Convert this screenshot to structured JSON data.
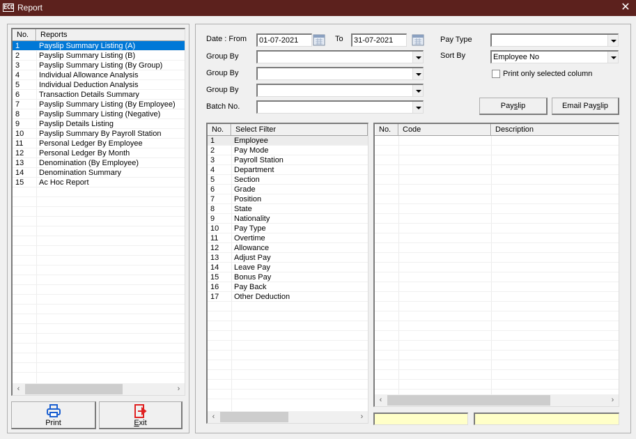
{
  "window": {
    "title": "Report",
    "app_icon": "ECO",
    "close_glyph": "✕"
  },
  "reports": {
    "columns": [
      "No.",
      "Reports"
    ],
    "selected_index": 0,
    "rows": [
      {
        "no": "1",
        "name": "Payslip Summary Listing (A)"
      },
      {
        "no": "2",
        "name": "Payslip Summary Listing (B)"
      },
      {
        "no": "3",
        "name": "Payslip Summary Listing (By Group)"
      },
      {
        "no": "4",
        "name": "Individual Allowance Analysis"
      },
      {
        "no": "5",
        "name": "Individual Deduction Analysis"
      },
      {
        "no": "6",
        "name": "Transaction Details Summary"
      },
      {
        "no": "7",
        "name": "Payslip Summary Listing (By Employee)"
      },
      {
        "no": "8",
        "name": "Payslip Summary Listing (Negative)"
      },
      {
        "no": "9",
        "name": "Payslip Details Listing"
      },
      {
        "no": "10",
        "name": "Payslip Summary By Payroll Station"
      },
      {
        "no": "11",
        "name": "Personal Ledger By Employee"
      },
      {
        "no": "12",
        "name": "Personal Ledger By Month"
      },
      {
        "no": "13",
        "name": "Denomination (By Employee)"
      },
      {
        "no": "14",
        "name": "Denomination Summary"
      },
      {
        "no": "15",
        "name": "Ac Hoc Report"
      }
    ],
    "scroll_left": "‹",
    "scroll_right": "›"
  },
  "buttons": {
    "print": "Print",
    "exit_first": "E",
    "exit_rest": "xit",
    "payslip_pre": "Pay",
    "payslip_u": "s",
    "payslip_post": "lip",
    "email_pre": "Email Pay",
    "email_u": "s",
    "email_post": "lip"
  },
  "form": {
    "date_from_label": "Date : From",
    "date_from_value": "01-07-2021",
    "date_to_label": "To",
    "date_to_value": "31-07-2021",
    "group_by_1_label": "Group By",
    "group_by_1_value": "",
    "group_by_2_label": "Group By",
    "group_by_2_value": "",
    "group_by_3_label": "Group By",
    "group_by_3_value": "",
    "batch_no_label": "Batch No.",
    "batch_no_value": "",
    "pay_type_label": "Pay Type",
    "pay_type_value": "",
    "sort_by_label": "Sort By",
    "sort_by_value": "Employee No",
    "print_selected_label": "Print only selected column",
    "print_selected_checked": false
  },
  "filters": {
    "columns": [
      "No.",
      "Select Filter"
    ],
    "rows": [
      {
        "no": "1",
        "name": "Employee"
      },
      {
        "no": "2",
        "name": "Pay Mode"
      },
      {
        "no": "3",
        "name": "Payroll Station"
      },
      {
        "no": "4",
        "name": "Department"
      },
      {
        "no": "5",
        "name": "Section"
      },
      {
        "no": "6",
        "name": "Grade"
      },
      {
        "no": "7",
        "name": "Position"
      },
      {
        "no": "8",
        "name": "State"
      },
      {
        "no": "9",
        "name": "Nationality"
      },
      {
        "no": "10",
        "name": "Pay Type"
      },
      {
        "no": "11",
        "name": "Overtime"
      },
      {
        "no": "12",
        "name": "Allowance"
      },
      {
        "no": "13",
        "name": "Adjust Pay"
      },
      {
        "no": "14",
        "name": "Leave Pay"
      },
      {
        "no": "15",
        "name": "Bonus Pay"
      },
      {
        "no": "16",
        "name": "Pay Back"
      },
      {
        "no": "17",
        "name": "Other Deduction"
      }
    ]
  },
  "codes": {
    "columns": [
      "No.",
      "Code",
      "Description"
    ],
    "rows": []
  },
  "status": {
    "left": "",
    "right": ""
  },
  "colors": {
    "titlebar": "#5c211d",
    "selection": "#0078d7",
    "status_fill": "#ffffc8"
  }
}
